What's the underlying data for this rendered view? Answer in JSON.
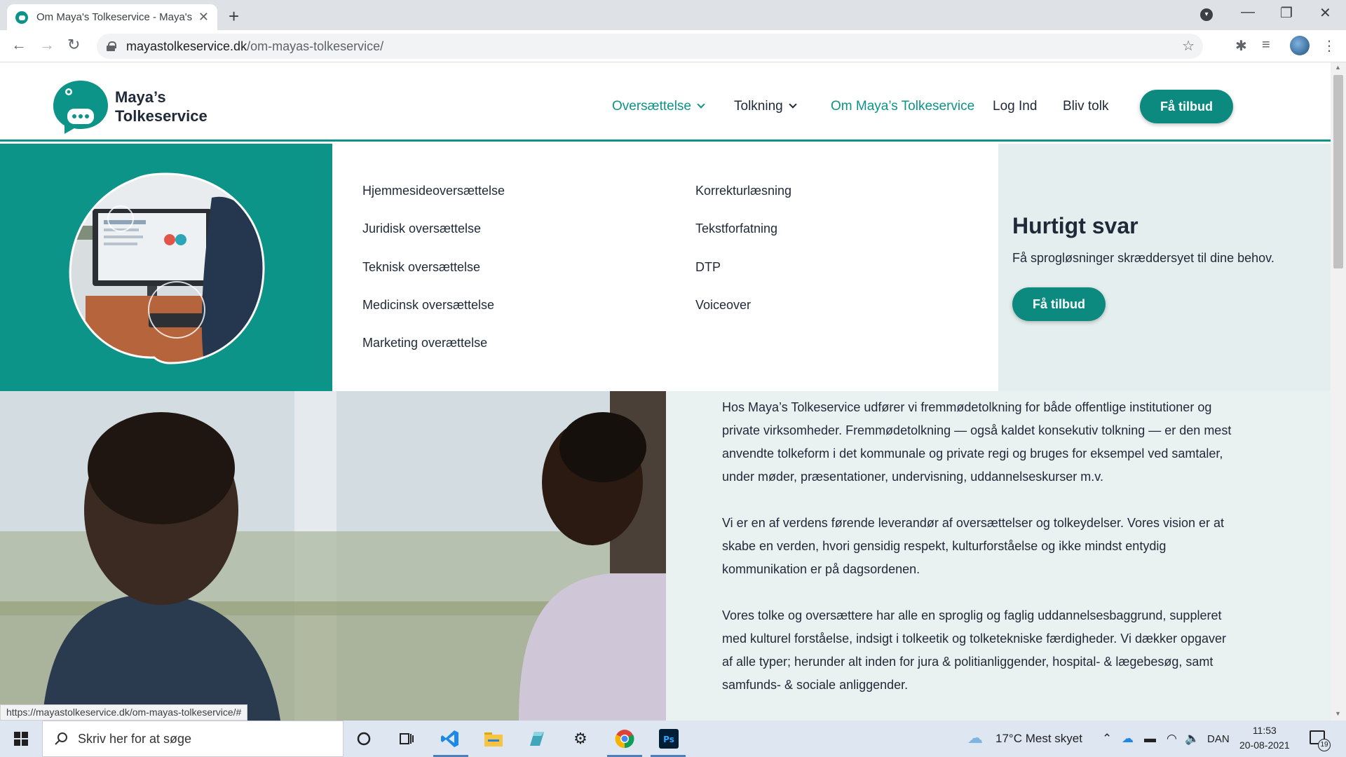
{
  "browser": {
    "tab_title": "Om Maya's Tolkeservice - Maya's",
    "url_host": "mayastolkeservice.dk",
    "url_path": "/om-mayas-tolkeservice/"
  },
  "site": {
    "logo_line1": "Maya’s",
    "logo_line2": "Tolkeservice",
    "nav": {
      "oversaettelse": "Oversættelse",
      "tolkning": "Tolkning",
      "om": "Om Maya’s Tolkeservice",
      "login": "Log Ind",
      "bliv_tolk": "Bliv tolk",
      "cta": "Få tilbud"
    },
    "accent_color": "#0d9488"
  },
  "mega_menu": {
    "col1": [
      "Hjemmesideoversættelse",
      "Juridisk oversættelse",
      "Teknisk oversættelse",
      "Medicinsk oversættelse",
      "Marketing overættelse"
    ],
    "col2": [
      "Korrekturlæsning",
      "Tekstforfatning",
      "DTP",
      "Voiceover"
    ],
    "promo_title": "Hurtigt svar",
    "promo_sub": "Få sprogløsninger skræddersyet til dine behov.",
    "promo_cta": "Få tilbud"
  },
  "content": {
    "p1": "Hos Maya’s Tolkeservice udfører vi fremmødetolkning for både offentlige institutioner og private virksomheder. Fremmødetolkning — også kaldet konsekutiv tolkning — er den mest anvendte tolkeform i det kommunale og private regi og bruges for eksempel ved samtaler, under møder, præsentationer, undervisning, uddannelseskurser m.v.",
    "p2": "Vi er en af verdens førende leverandør af oversættelser og tolkeydelser. Vores vision er at skabe en verden, hvori gensidig respekt, kulturforståelse og ikke mindst entydig kommunikation er på dagsordenen.",
    "p3": "Vores tolke og oversættere har alle en sproglig og faglig uddannelsesbaggrund, suppleret med kulturel forståelse, indsigt i tolkeetik og tolketekniske færdigheder. Vi dækker opgaver af alle typer; herunder alt inden for jura & politianliggender, hospital- & lægebesøg, samt samfunds- & sociale anliggender."
  },
  "status_url": "https://mayastolkeservice.dk/om-mayas-tolkeservice/#",
  "taskbar": {
    "search_placeholder": "Skriv her for at søge",
    "weather": "17°C  Mest skyet",
    "lang": "DAN",
    "time": "11:53",
    "date": "20-08-2021",
    "notif_count": "19"
  }
}
